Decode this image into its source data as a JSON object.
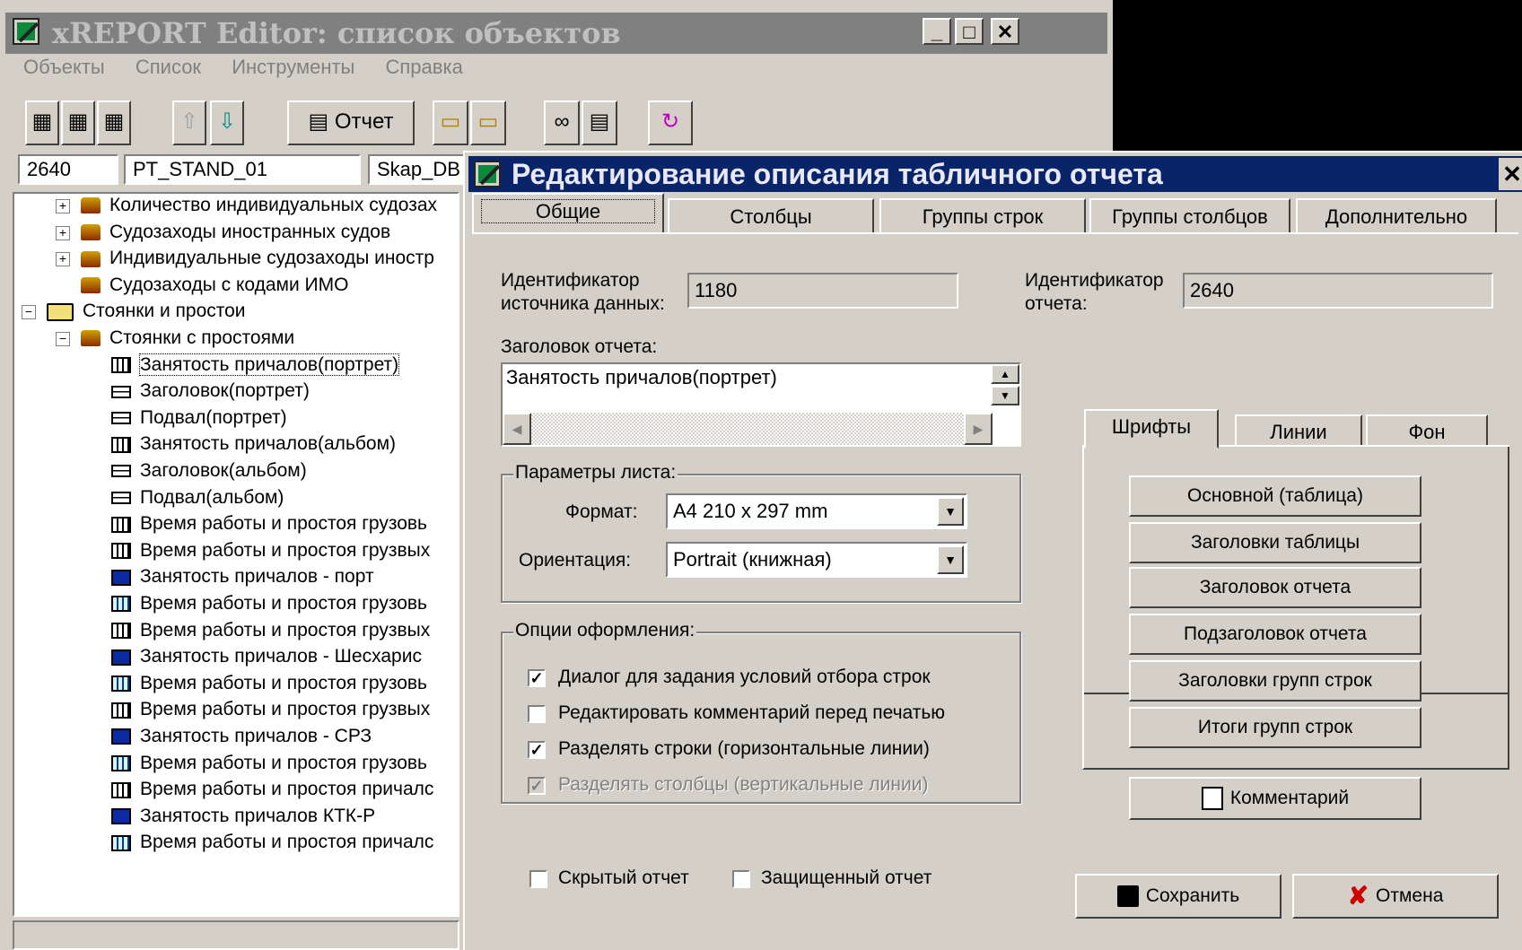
{
  "main_window": {
    "title": "xREPORT Editor: список объектов",
    "controls": {
      "minimize": "_",
      "maximize": "□",
      "close": "✕"
    },
    "menu": [
      "Объекты",
      "Список",
      "Инструменты",
      "Справка"
    ],
    "toolbar": {
      "report_label": "Отчет"
    },
    "fields": {
      "id": "2640",
      "code": "PT_STAND_01",
      "db": "Skap_DB"
    }
  },
  "tree": {
    "items": [
      {
        "label": "Количество индивидуальных судозах",
        "icon": "people-icon"
      },
      {
        "label": "Судозаходы иностранных судов",
        "icon": "people-icon"
      },
      {
        "label": "Индивидуальные судозаходы иностр",
        "icon": "people-icon"
      },
      {
        "label": "Судозаходы с кодами ИМО",
        "icon": "people-icon"
      },
      {
        "label": "Стоянки и простои",
        "icon": "folder-icon"
      },
      {
        "label": "Стоянки с простоями",
        "icon": "people-icon"
      },
      {
        "label": "Занятость причалов(портрет)",
        "icon": "table-icon"
      },
      {
        "label": "Заголовок(портрет)",
        "icon": "header-icon"
      },
      {
        "label": "Подвал(портрет)",
        "icon": "header-icon"
      },
      {
        "label": "Занятость причалов(альбом)",
        "icon": "table-icon"
      },
      {
        "label": "Заголовок(альбом)",
        "icon": "header-icon"
      },
      {
        "label": "Подвал(альбом)",
        "icon": "header-icon"
      },
      {
        "label": "Время работы и простоя грузовь",
        "icon": "table-icon"
      },
      {
        "label": "Время работы и простоя грузвых",
        "icon": "table-icon"
      },
      {
        "label": "Занятость причалов - порт",
        "icon": "chart-icon"
      },
      {
        "label": "Время работы и простоя грузовь",
        "icon": "crosstab-icon"
      },
      {
        "label": "Время работы и простоя грузвых",
        "icon": "table-icon"
      },
      {
        "label": "Занятость причалов - Шесхарис",
        "icon": "chart-icon"
      },
      {
        "label": "Время работы и простоя грузовь",
        "icon": "crosstab-icon"
      },
      {
        "label": "Время работы и простоя грузвых",
        "icon": "table-icon"
      },
      {
        "label": "Занятость причалов - СРЗ",
        "icon": "chart-icon"
      },
      {
        "label": "Время работы и простоя грузовь",
        "icon": "crosstab-icon"
      },
      {
        "label": "Время работы и простоя причалс",
        "icon": "table-icon"
      },
      {
        "label": "Занятость причалов КТК-Р",
        "icon": "chart-icon"
      },
      {
        "label": "Время работы и простоя причалс",
        "icon": "crosstab-icon"
      }
    ]
  },
  "dialog": {
    "title": "Редактирование описания табличного отчета",
    "close": "✕",
    "tabs": [
      "Общие",
      "Столбцы",
      "Группы строк",
      "Группы столбцов",
      "Дополнительно"
    ],
    "source_id": {
      "label_1": "Идентификатор",
      "label_2": "источника данных:",
      "value": "1180"
    },
    "report_id": {
      "label_1": "Идентификатор",
      "label_2": "отчета:",
      "value": "2640"
    },
    "report_title": {
      "label": "Заголовок отчета:",
      "value": "Занятость причалов(портрет)"
    },
    "sheet_params": {
      "legend": "Параметры листа:",
      "format_label": "Формат:",
      "format_value": "A4 210 x 297 mm",
      "orientation_label": "Ориентация:",
      "orientation_value": "Portrait (книжная)"
    },
    "design_options": {
      "legend": "Опции оформления:",
      "options": [
        {
          "label": "Диалог для задания условий отбора строк",
          "checked": true,
          "disabled": false
        },
        {
          "label": "Редактировать комментарий перед печатью",
          "checked": false,
          "disabled": false
        },
        {
          "label": "Разделять строки (горизонтальные линии)",
          "checked": true,
          "disabled": false
        },
        {
          "label": "Разделять столбцы (вертикальные линии)",
          "checked": true,
          "disabled": true
        }
      ]
    },
    "style_tabs": [
      "Шрифты",
      "Линии",
      "Фон"
    ],
    "font_buttons": [
      "Основной (таблица)",
      "Заголовки таблицы",
      "Заголовок отчета",
      "Подзаголовок отчета",
      "Заголовки групп строк",
      "Итоги групп строк"
    ],
    "comment_button": "Комментарий",
    "hidden_report": {
      "label": "Скрытый отчет",
      "checked": false
    },
    "protected_report": {
      "label": "Защищенный отчет",
      "checked": false
    },
    "save_button": "Сохранить",
    "cancel_button": "Отмена"
  },
  "colors": {
    "titlebar_active": "#0a246a",
    "titlebar_inactive": "#808080",
    "face": "#d4d0c8"
  }
}
